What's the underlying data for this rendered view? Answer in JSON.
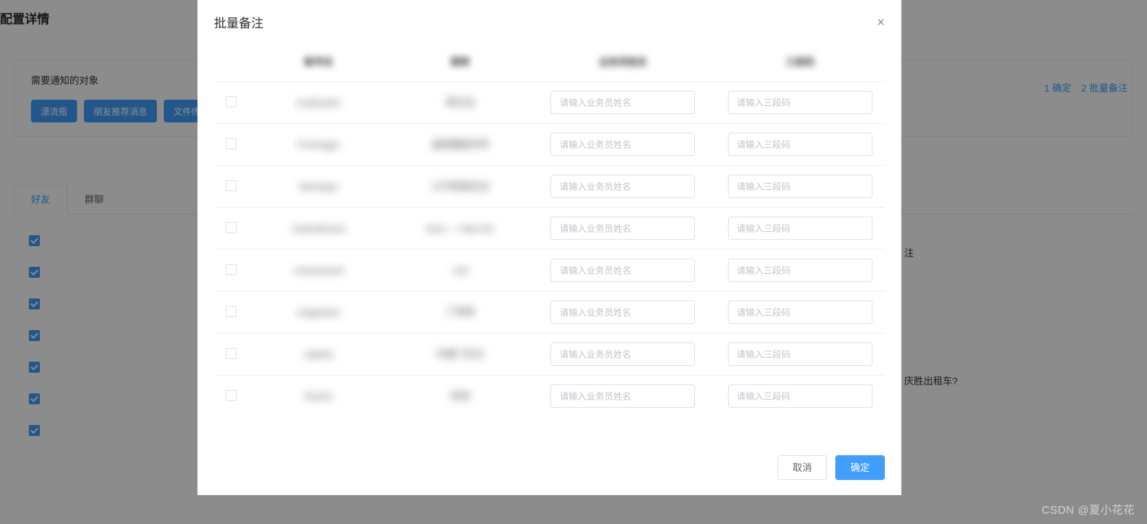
{
  "bg": {
    "page_title": "配置详情",
    "card_title": "需要通知的对象",
    "tags": [
      "漂流瓶",
      "朋友推荐消息",
      "文件传输"
    ],
    "header_links": [
      "1 确定",
      "2 批量备注"
    ],
    "tabs": [
      "好友",
      "群聊"
    ],
    "remark_header": "注",
    "remark_sample": "庆胜出租车?",
    "checked_count": 7
  },
  "dialog": {
    "title": "批量备注",
    "close_label": "×",
    "headers": {
      "h1": "账号名",
      "h2": "昵称",
      "h3": "业务员姓名",
      "h4": "三段码"
    },
    "placeholder_name": "请输入业务员姓名",
    "placeholder_code": "请输入三段码",
    "rows": [
      {
        "c1": "hualiushin",
        "c2": "原生态"
      },
      {
        "c1": "Promager",
        "c2": "温柔覆盖世界"
      },
      {
        "c1": "Nemajue",
        "c2": "江中帆船在远"
      },
      {
        "c1": "chamellcaun",
        "c2": "teny — Haa her"
      },
      {
        "c1": "cmonement",
        "c2": "null"
      },
      {
        "c1": "Angelstun",
        "c2": "丁零零"
      },
      {
        "c1": "nabefu",
        "c2": "刘德门先生"
      },
      {
        "c1": "Rushu",
        "c2": "秀清"
      }
    ],
    "cancel": "取消",
    "confirm": "确定"
  },
  "watermark": "CSDN @夏小花花"
}
